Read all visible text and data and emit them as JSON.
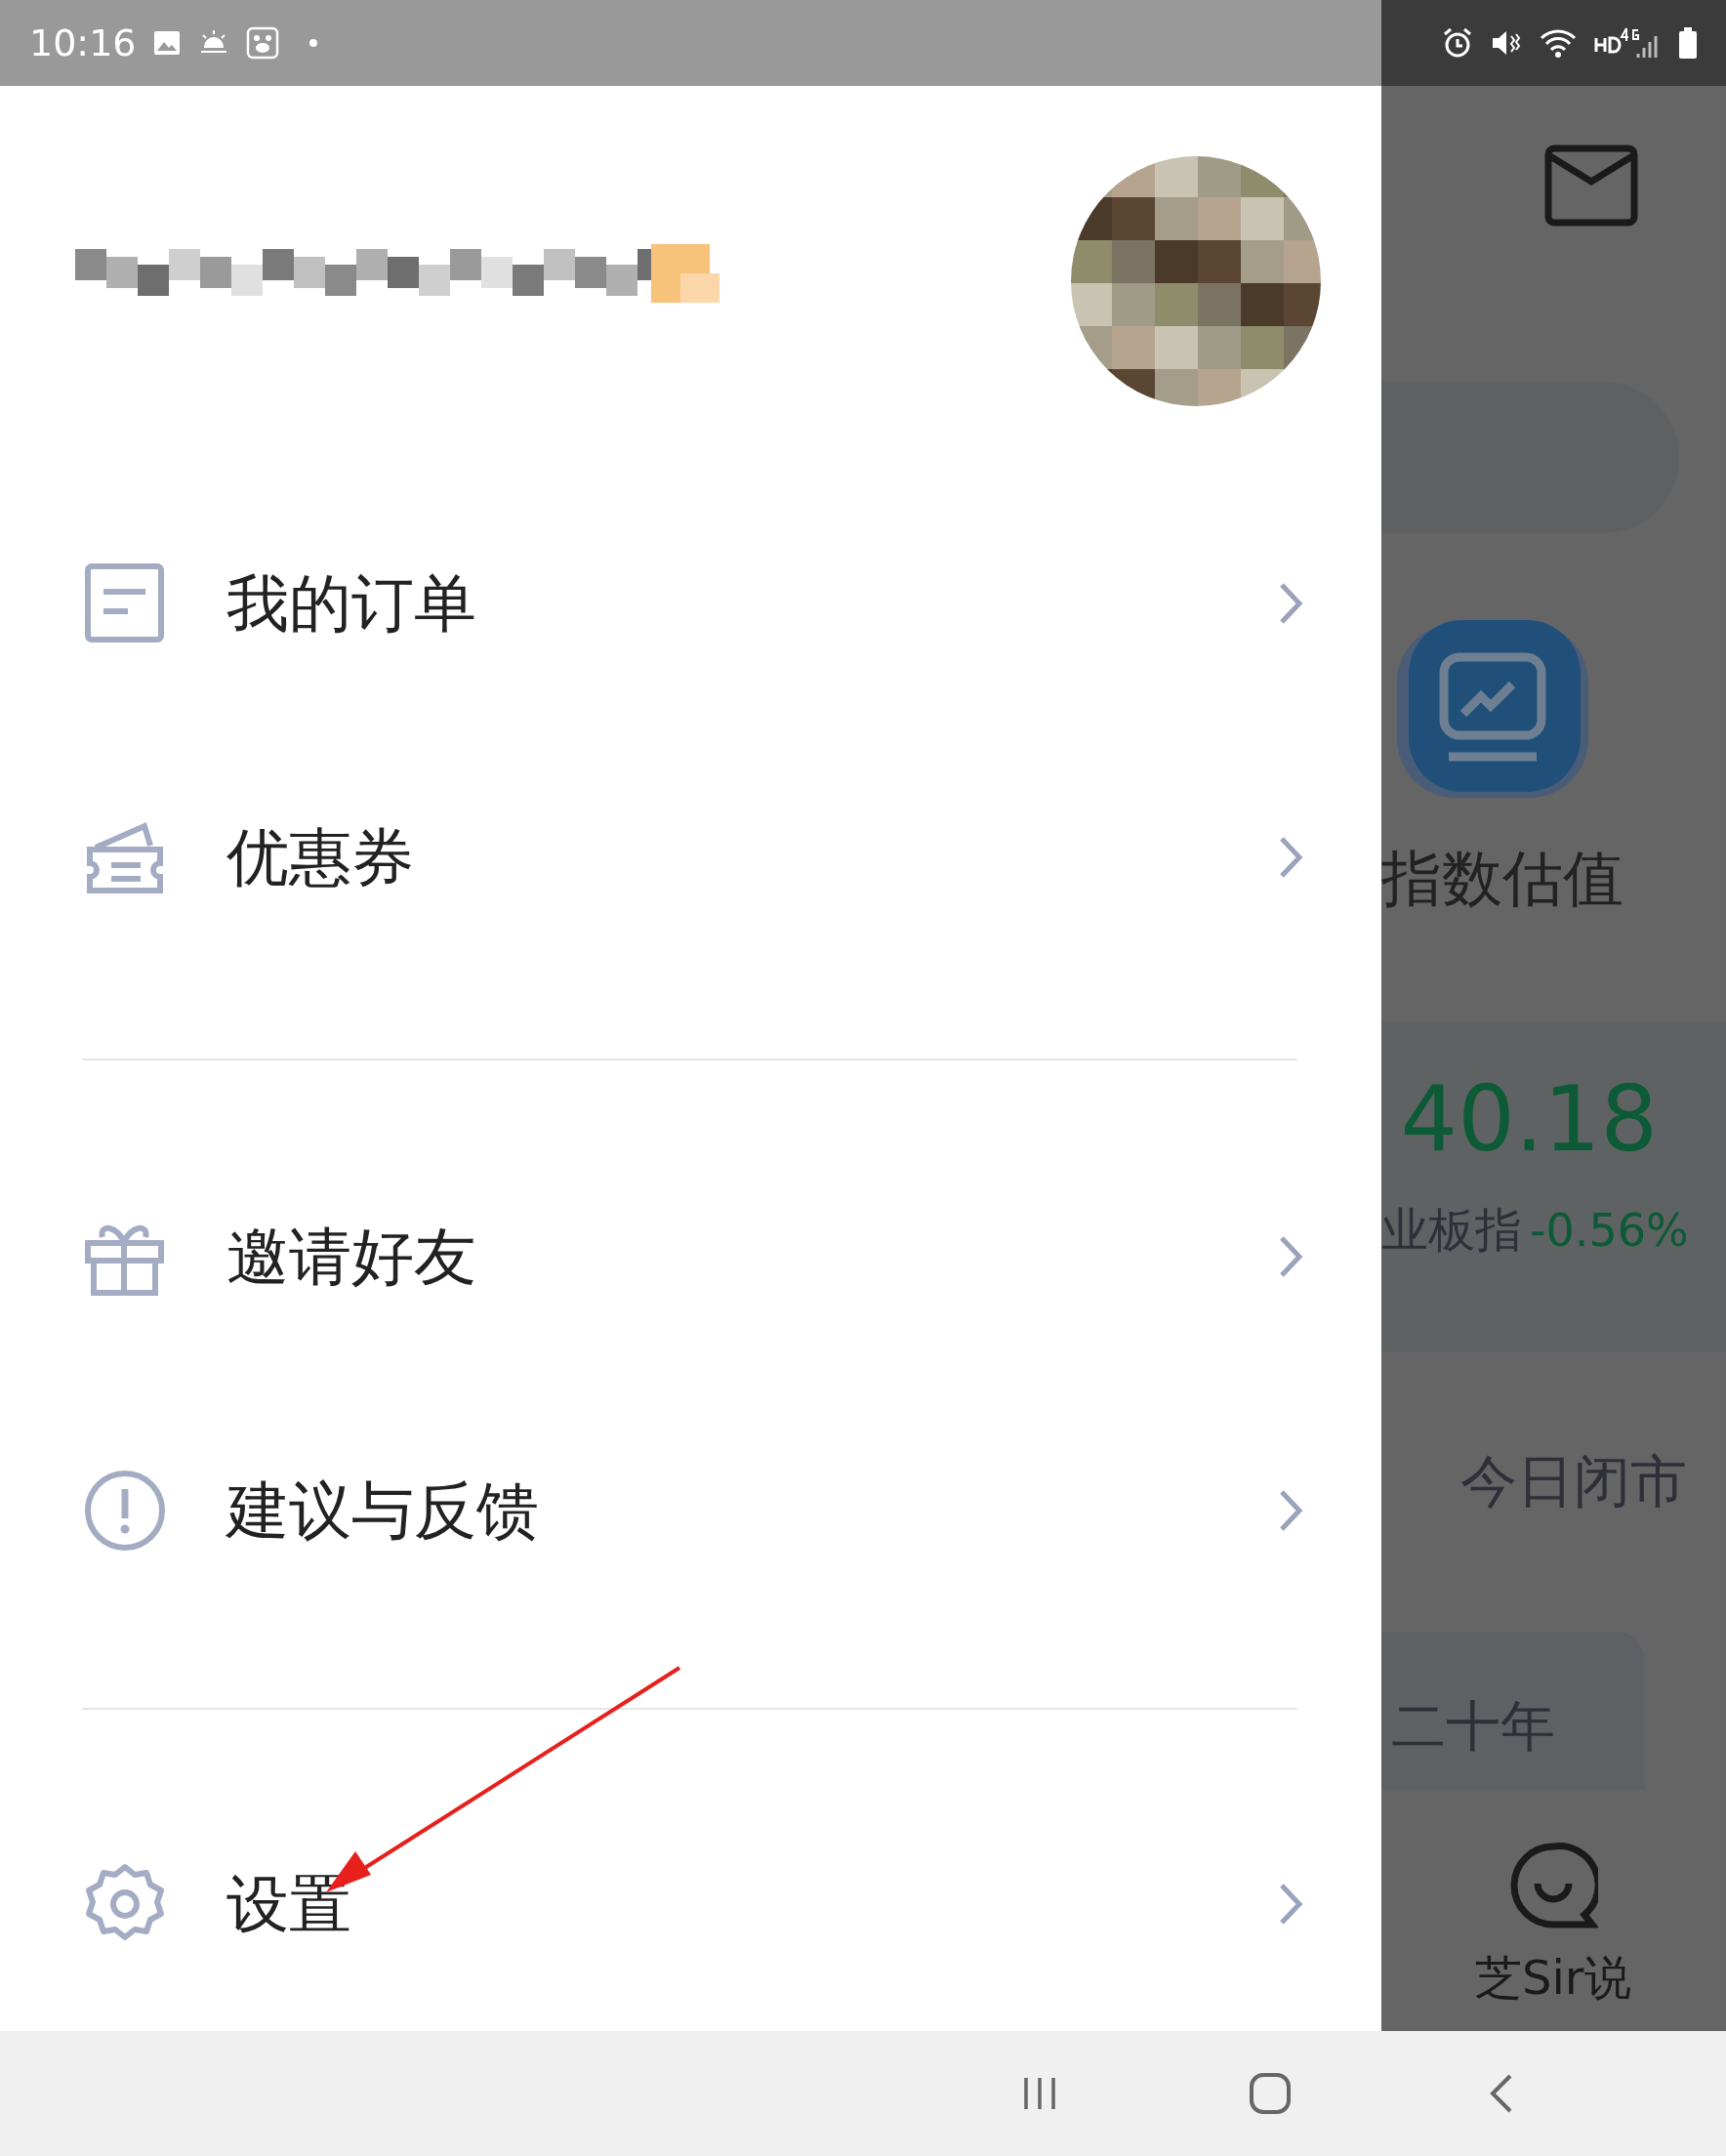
{
  "status_bar": {
    "time": "10:16"
  },
  "drawer": {
    "menu_groups": [
      [
        {
          "kind": "order",
          "label": "我的订单"
        },
        {
          "kind": "coupon",
          "label": "优惠券"
        }
      ],
      [
        {
          "kind": "gift",
          "label": "邀请好友"
        },
        {
          "kind": "feedback",
          "label": "建议与反馈"
        }
      ],
      [
        {
          "kind": "settings",
          "label": "设置"
        }
      ]
    ]
  },
  "background_app": {
    "tool_label": "指数估值",
    "index_value": "40.18",
    "index_name": "业板指",
    "index_change": "-0.56%",
    "market_status": "今日闭市",
    "period_tab": "二十年",
    "chat_label": "芝Sir说"
  }
}
